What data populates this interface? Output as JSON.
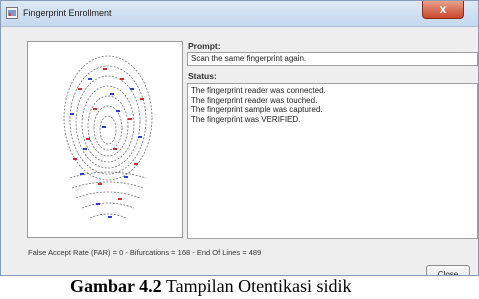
{
  "window": {
    "title": "Fingerprint Enrollment",
    "close_glyph": "x"
  },
  "prompt": {
    "label": "Prompt:",
    "value": "Scan the same fingerprint again."
  },
  "status": {
    "label": "Status:",
    "lines": [
      "The fingerprint reader was connected.",
      "The fingerprint reader was touched.",
      "The fingerprint sample was captured.",
      "The fingerprint was VERIFIED."
    ]
  },
  "info": {
    "text": "False Accept Rate (FAR) = 0  -  Bifurcations = 168  -  End Of Lines = 489"
  },
  "buttons": {
    "close_label": "Close"
  },
  "caption": {
    "label": "Gambar 4.2",
    "text": " Tampilan Otentikasi sidik"
  },
  "colors": {
    "ridge": "#555555",
    "minutia_red": "#d42a2a",
    "minutia_blue": "#2a3fd4"
  }
}
